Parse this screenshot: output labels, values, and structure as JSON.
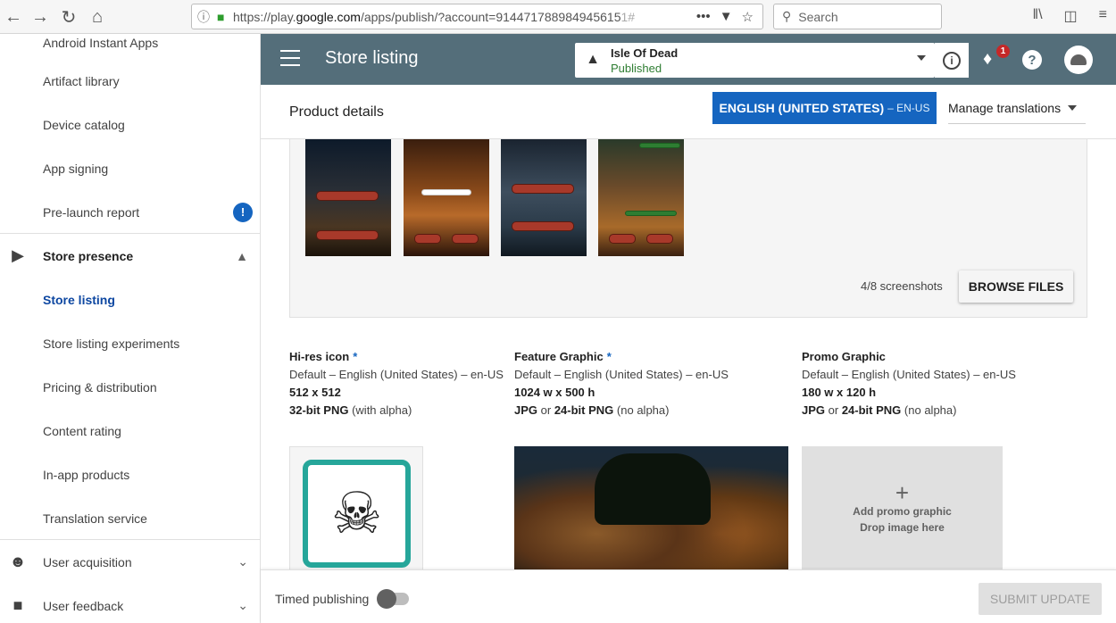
{
  "browser": {
    "url_prefix": "https://play.",
    "url_domain": "google.com",
    "url_rest": "/apps/publish/?account=914471788984945615",
    "url_tail": "1#",
    "search_placeholder": "Search"
  },
  "sidebar": {
    "items": [
      {
        "label": "Android Instant Apps"
      },
      {
        "label": "Artifact library"
      },
      {
        "label": "Device catalog"
      },
      {
        "label": "App signing"
      },
      {
        "label": "Pre-launch report",
        "badge": "!"
      }
    ],
    "store_presence": {
      "label": "Store presence",
      "children": [
        {
          "label": "Store listing",
          "active": true
        },
        {
          "label": "Store listing experiments"
        },
        {
          "label": "Pricing & distribution"
        },
        {
          "label": "Content rating"
        },
        {
          "label": "In-app products"
        },
        {
          "label": "Translation service"
        }
      ]
    },
    "user_acquisition": {
      "label": "User acquisition"
    },
    "user_feedback": {
      "label": "User feedback"
    }
  },
  "header": {
    "title": "Store listing",
    "app_name": "Isle Of Dead",
    "app_status": "Published",
    "notification_count": "1"
  },
  "product_details": {
    "title": "Product details",
    "language": "ENGLISH (UNITED STATES)",
    "language_code": "– EN-US",
    "manage_translations": "Manage translations"
  },
  "screenshots": {
    "thumbs": [
      {
        "top_label": "NEW GAME",
        "bottom_label": "EXIT"
      },
      {
        "top_label": "",
        "bottom_label": "BACK"
      },
      {
        "top_label": "QUEST BOARD",
        "bottom_label": "BATTLE ISLES"
      },
      {
        "top_label": "",
        "bottom_label": "ATTACK"
      }
    ],
    "count": "4/8 screenshots",
    "browse_label": "BROWSE FILES"
  },
  "graphics": {
    "hires": {
      "title": "Hi-res icon",
      "locale": "Default – English (United States) – en-US",
      "size": "512 x 512",
      "format_bold": "32-bit PNG",
      "format_note": "(with alpha)"
    },
    "feature": {
      "title": "Feature Graphic",
      "locale": "Default – English (United States) – en-US",
      "size": "1024 w x 500 h",
      "format_a": "JPG",
      "format_or": "or",
      "format_b": "24-bit PNG",
      "format_note": "(no alpha)"
    },
    "promo": {
      "title": "Promo Graphic",
      "locale": "Default – English (United States) – en-US",
      "size": "180 w x 120 h",
      "format_a": "JPG",
      "format_or": "or",
      "format_b": "24-bit PNG",
      "format_note": "(no alpha)",
      "add_label": "Add promo graphic",
      "drop_label": "Drop image here"
    }
  },
  "footer": {
    "timed_publishing": "Timed publishing",
    "timed_enabled": false,
    "submit_label": "SUBMIT UPDATE"
  },
  "colors": {
    "topbar": "#546e7a",
    "primary": "#1565c0",
    "published": "#2e7d32",
    "badge": "#c62828"
  }
}
